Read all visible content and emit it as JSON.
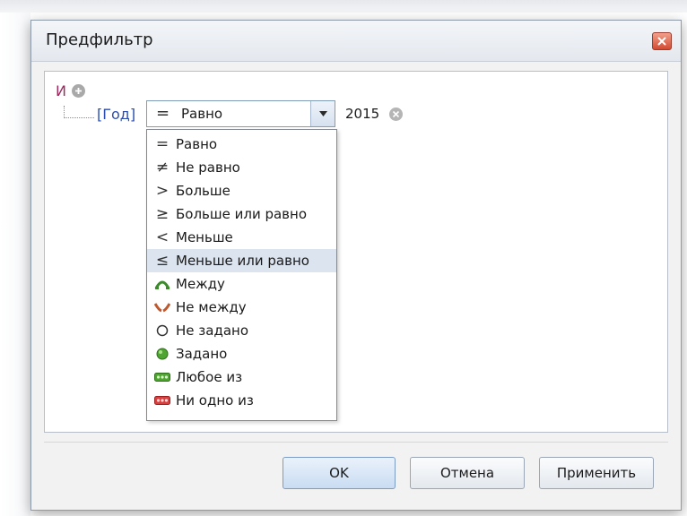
{
  "dialog": {
    "title": "Предфильтр"
  },
  "filter": {
    "group_operator": "И",
    "field": "[Год]",
    "operator_selected": "Равно",
    "value": "2015"
  },
  "operators": [
    {
      "icon": "equals-icon",
      "label": "Равно"
    },
    {
      "icon": "not-equals-icon",
      "label": "Не равно"
    },
    {
      "icon": "greater-icon",
      "label": "Больше"
    },
    {
      "icon": "greater-or-equal-icon",
      "label": "Больше или равно"
    },
    {
      "icon": "less-icon",
      "label": "Меньше"
    },
    {
      "icon": "less-or-equal-icon",
      "label": "Меньше или равно"
    },
    {
      "icon": "between-icon",
      "label": "Между"
    },
    {
      "icon": "not-between-icon",
      "label": "Не между"
    },
    {
      "icon": "is-null-icon",
      "label": "Не задано"
    },
    {
      "icon": "is-not-null-icon",
      "label": "Задано"
    },
    {
      "icon": "any-of-icon",
      "label": "Любое из"
    },
    {
      "icon": "none-of-icon",
      "label": "Ни одно из"
    }
  ],
  "highlighted_operator": "Меньше или равно",
  "buttons": {
    "ok": "OK",
    "cancel": "Отмена",
    "apply": "Применить"
  },
  "colors": {
    "group_operator": "#9c2a5e",
    "field": "#2a4fb0",
    "highlight": "#dce4f0"
  }
}
